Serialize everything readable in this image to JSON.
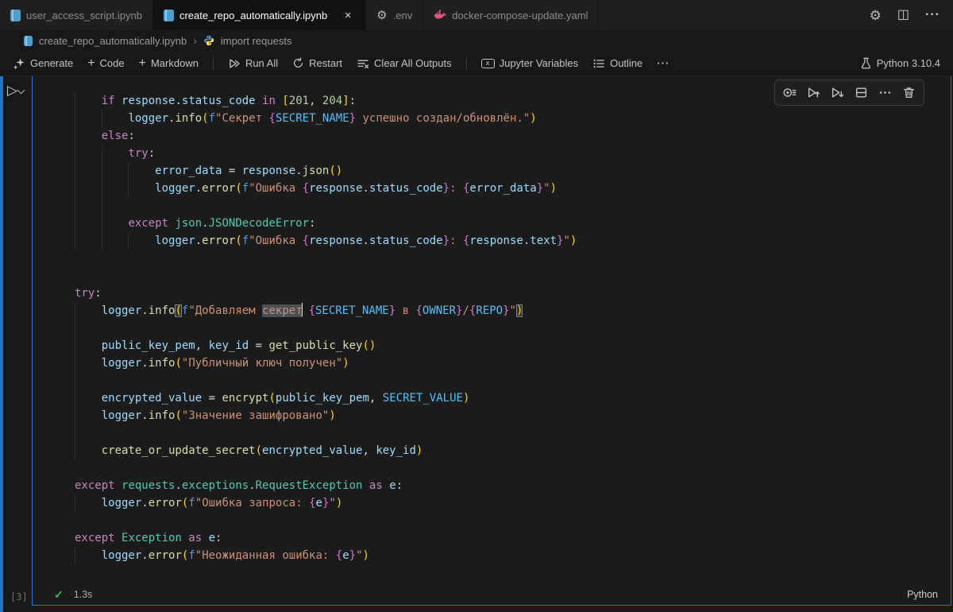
{
  "window": {
    "tabs": [
      {
        "label": "user_access_script.ipynb",
        "icon": "notebook-icon"
      },
      {
        "label": "create_repo_automatically.ipynb",
        "icon": "notebook-icon",
        "close": "×"
      },
      {
        "label": ".env",
        "icon": "gear-icon"
      },
      {
        "label": "docker-compose-update.yaml",
        "icon": "docker-whale-icon"
      }
    ],
    "actions": {
      "gear": "⚙",
      "split": "◫",
      "more": "···"
    }
  },
  "breadcrumb": {
    "file": "create_repo_automatically.ipynb",
    "separator": "›",
    "symbol": "import requests"
  },
  "toolbar": {
    "generate": "Generate",
    "plus": "+",
    "code": "Code",
    "markdown": "Markdown",
    "run_all": "Run All",
    "restart": "Restart",
    "clear_all": "Clear All Outputs",
    "jupyter_variables": "Jupyter Variables",
    "variables_glyph": "x",
    "outline": "Outline",
    "more": "···",
    "kernel": "Python 3.10.4"
  },
  "cell": {
    "run_glyph": "▷",
    "execution_count": "[3]",
    "status_check": "✓",
    "status_time": "1.3s",
    "language": "Python",
    "lines": [
      {
        "g": [
          0
        ],
        "t": [
          [
            "ws",
            "    "
          ],
          [
            "kw",
            "if "
          ],
          [
            "va",
            "response"
          ],
          [
            "pu",
            "."
          ],
          [
            "va",
            "status_code"
          ],
          [
            "kw",
            " in "
          ],
          [
            "b1",
            "["
          ],
          [
            "nu",
            "201"
          ],
          [
            "pu",
            ", "
          ],
          [
            "nu",
            "204"
          ],
          [
            "b1",
            "]"
          ],
          [
            "pu",
            ":"
          ]
        ]
      },
      {
        "g": [
          0,
          4
        ],
        "t": [
          [
            "ws",
            "        "
          ],
          [
            "va",
            "logger"
          ],
          [
            "pu",
            "."
          ],
          [
            "fn",
            "info"
          ],
          [
            "b1",
            "("
          ],
          [
            "fp",
            "f"
          ],
          [
            "st",
            "\"Секрет "
          ],
          [
            "b2",
            "{"
          ],
          [
            "co",
            "SECRET_NAME"
          ],
          [
            "b2",
            "}"
          ],
          [
            "st",
            " успешно создан/обновлён.\""
          ],
          [
            "b1",
            ")"
          ]
        ]
      },
      {
        "g": [
          0
        ],
        "t": [
          [
            "ws",
            "    "
          ],
          [
            "kw",
            "else"
          ],
          [
            "pu",
            ":"
          ]
        ]
      },
      {
        "g": [
          0,
          4
        ],
        "t": [
          [
            "ws",
            "        "
          ],
          [
            "kw",
            "try"
          ],
          [
            "pu",
            ":"
          ]
        ]
      },
      {
        "g": [
          0,
          4,
          8
        ],
        "t": [
          [
            "ws",
            "            "
          ],
          [
            "va",
            "error_data"
          ],
          [
            "pu",
            " = "
          ],
          [
            "va",
            "response"
          ],
          [
            "pu",
            "."
          ],
          [
            "fn",
            "json"
          ],
          [
            "b1",
            "()"
          ]
        ]
      },
      {
        "g": [
          0,
          4,
          8
        ],
        "t": [
          [
            "ws",
            "            "
          ],
          [
            "va",
            "logger"
          ],
          [
            "pu",
            "."
          ],
          [
            "fn",
            "error"
          ],
          [
            "b1",
            "("
          ],
          [
            "fp",
            "f"
          ],
          [
            "st",
            "\"Ошибка "
          ],
          [
            "b2",
            "{"
          ],
          [
            "va",
            "response"
          ],
          [
            "pu",
            "."
          ],
          [
            "va",
            "status_code"
          ],
          [
            "b2",
            "}"
          ],
          [
            "st",
            ": "
          ],
          [
            "b2",
            "{"
          ],
          [
            "va",
            "error_data"
          ],
          [
            "b2",
            "}"
          ],
          [
            "st",
            "\""
          ],
          [
            "b1",
            ")"
          ]
        ]
      },
      {
        "g": [
          0,
          4
        ],
        "t": []
      },
      {
        "g": [
          0,
          4
        ],
        "t": [
          [
            "ws",
            "        "
          ],
          [
            "kw",
            "except "
          ],
          [
            "cl",
            "json"
          ],
          [
            "pu",
            "."
          ],
          [
            "cl",
            "JSONDecodeError"
          ],
          [
            "pu",
            ":"
          ]
        ]
      },
      {
        "g": [
          0,
          4,
          8
        ],
        "t": [
          [
            "ws",
            "            "
          ],
          [
            "va",
            "logger"
          ],
          [
            "pu",
            "."
          ],
          [
            "fn",
            "error"
          ],
          [
            "b1",
            "("
          ],
          [
            "fp",
            "f"
          ],
          [
            "st",
            "\"Ошибка "
          ],
          [
            "b2",
            "{"
          ],
          [
            "va",
            "response"
          ],
          [
            "pu",
            "."
          ],
          [
            "va",
            "status_code"
          ],
          [
            "b2",
            "}"
          ],
          [
            "st",
            ": "
          ],
          [
            "b2",
            "{"
          ],
          [
            "va",
            "response"
          ],
          [
            "pu",
            "."
          ],
          [
            "va",
            "text"
          ],
          [
            "b2",
            "}"
          ],
          [
            "st",
            "\""
          ],
          [
            "b1",
            ")"
          ]
        ]
      },
      {
        "g": [],
        "t": []
      },
      {
        "g": [],
        "t": []
      },
      {
        "g": [],
        "t": [
          [
            "kw",
            "try"
          ],
          [
            "pu",
            ":"
          ]
        ]
      },
      {
        "g": [
          0
        ],
        "t": [
          [
            "ws",
            "    "
          ],
          [
            "va",
            "logger"
          ],
          [
            "pu",
            "."
          ],
          [
            "fn",
            "info"
          ],
          [
            "bm",
            "("
          ],
          [
            "fp",
            "f"
          ],
          [
            "st",
            "\"Добавляем "
          ],
          [
            "sel",
            "секрет"
          ],
          [
            "cur",
            ""
          ],
          [
            "st",
            " "
          ],
          [
            "b2",
            "{"
          ],
          [
            "co",
            "SECRET_NAME"
          ],
          [
            "b2",
            "}"
          ],
          [
            "st",
            " в "
          ],
          [
            "b2",
            "{"
          ],
          [
            "co",
            "OWNER"
          ],
          [
            "b2",
            "}"
          ],
          [
            "st",
            "/"
          ],
          [
            "b2",
            "{"
          ],
          [
            "co",
            "REPO"
          ],
          [
            "b2",
            "}"
          ],
          [
            "st",
            "\""
          ],
          [
            "bm",
            ")"
          ]
        ]
      },
      {
        "g": [
          0
        ],
        "t": []
      },
      {
        "g": [
          0
        ],
        "t": [
          [
            "ws",
            "    "
          ],
          [
            "va",
            "public_key_pem"
          ],
          [
            "pu",
            ", "
          ],
          [
            "va",
            "key_id"
          ],
          [
            "pu",
            " = "
          ],
          [
            "fn",
            "get_public_key"
          ],
          [
            "b1",
            "()"
          ]
        ]
      },
      {
        "g": [
          0
        ],
        "t": [
          [
            "ws",
            "    "
          ],
          [
            "va",
            "logger"
          ],
          [
            "pu",
            "."
          ],
          [
            "fn",
            "info"
          ],
          [
            "b1",
            "("
          ],
          [
            "st",
            "\"Публичный ключ получен\""
          ],
          [
            "b1",
            ")"
          ]
        ]
      },
      {
        "g": [
          0
        ],
        "t": []
      },
      {
        "g": [
          0
        ],
        "t": [
          [
            "ws",
            "    "
          ],
          [
            "va",
            "encrypted_value"
          ],
          [
            "pu",
            " = "
          ],
          [
            "fn",
            "encrypt"
          ],
          [
            "b1",
            "("
          ],
          [
            "va",
            "public_key_pem"
          ],
          [
            "pu",
            ", "
          ],
          [
            "co",
            "SECRET_VALUE"
          ],
          [
            "b1",
            ")"
          ]
        ]
      },
      {
        "g": [
          0
        ],
        "t": [
          [
            "ws",
            "    "
          ],
          [
            "va",
            "logger"
          ],
          [
            "pu",
            "."
          ],
          [
            "fn",
            "info"
          ],
          [
            "b1",
            "("
          ],
          [
            "st",
            "\"Значение зашифровано\""
          ],
          [
            "b1",
            ")"
          ]
        ]
      },
      {
        "g": [
          0
        ],
        "t": []
      },
      {
        "g": [
          0
        ],
        "t": [
          [
            "ws",
            "    "
          ],
          [
            "fn",
            "create_or_update_secret"
          ],
          [
            "b1",
            "("
          ],
          [
            "va",
            "encrypted_value"
          ],
          [
            "pu",
            ", "
          ],
          [
            "va",
            "key_id"
          ],
          [
            "b1",
            ")"
          ]
        ]
      },
      {
        "g": [],
        "t": []
      },
      {
        "g": [],
        "t": [
          [
            "kw",
            "except "
          ],
          [
            "cl",
            "requests"
          ],
          [
            "pu",
            "."
          ],
          [
            "cl",
            "exceptions"
          ],
          [
            "pu",
            "."
          ],
          [
            "cl",
            "RequestException"
          ],
          [
            "kw",
            " as "
          ],
          [
            "va",
            "e"
          ],
          [
            "pu",
            ":"
          ]
        ]
      },
      {
        "g": [
          0
        ],
        "t": [
          [
            "ws",
            "    "
          ],
          [
            "va",
            "logger"
          ],
          [
            "pu",
            "."
          ],
          [
            "fn",
            "error"
          ],
          [
            "b1",
            "("
          ],
          [
            "fp",
            "f"
          ],
          [
            "st",
            "\"Ошибка запроса: "
          ],
          [
            "b2",
            "{"
          ],
          [
            "va",
            "e"
          ],
          [
            "b2",
            "}"
          ],
          [
            "st",
            "\""
          ],
          [
            "b1",
            ")"
          ]
        ]
      },
      {
        "g": [],
        "t": []
      },
      {
        "g": [],
        "t": [
          [
            "kw",
            "except "
          ],
          [
            "cl",
            "Exception"
          ],
          [
            "kw",
            " as "
          ],
          [
            "va",
            "e"
          ],
          [
            "pu",
            ":"
          ]
        ]
      },
      {
        "g": [
          0
        ],
        "t": [
          [
            "ws",
            "    "
          ],
          [
            "va",
            "logger"
          ],
          [
            "pu",
            "."
          ],
          [
            "fn",
            "error"
          ],
          [
            "b1",
            "("
          ],
          [
            "fp",
            "f"
          ],
          [
            "st",
            "\"Неожиданная ошибка: "
          ],
          [
            "b2",
            "{"
          ],
          [
            "va",
            "e"
          ],
          [
            "b2",
            "}"
          ],
          [
            "st",
            "\""
          ],
          [
            "b1",
            ")"
          ]
        ]
      }
    ]
  },
  "colors": {
    "accent_blue": "#2472c8",
    "background": "#181818",
    "keyword": "#c586c0",
    "variable": "#9cdcfe",
    "function": "#dcdcaa",
    "class": "#4ec9b0",
    "string": "#ce9178",
    "number": "#b5cea8",
    "constant": "#4fc1ff",
    "bracket_level1": "#ffd700",
    "bracket_level2": "#da70d6",
    "check_green": "#3fb950",
    "docker_pink": "#e0557e",
    "notebook_blue": "#4d9fd0"
  }
}
